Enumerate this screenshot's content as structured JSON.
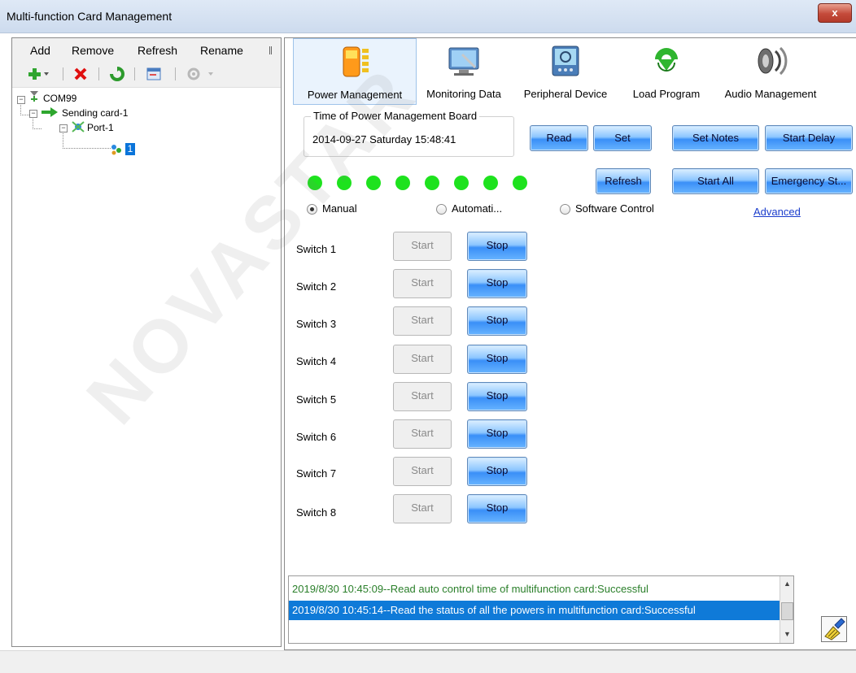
{
  "window": {
    "title": "Multi-function Card Management",
    "close_glyph": "x"
  },
  "menu": {
    "add": "Add",
    "remove": "Remove",
    "refresh": "Refresh",
    "rename": "Rename"
  },
  "tree": {
    "root": "COM99",
    "sending_card": "Sending card-1",
    "port": "Port-1",
    "card": "1"
  },
  "tabs": [
    {
      "label": "Power Management",
      "icon": "battery-icon"
    },
    {
      "label": "Monitoring Data",
      "icon": "monitor-icon"
    },
    {
      "label": "Peripheral Device",
      "icon": "device-icon"
    },
    {
      "label": "Load Program",
      "icon": "download-arrow-icon"
    },
    {
      "label": "Audio Management",
      "icon": "speaker-icon"
    }
  ],
  "time_group": {
    "legend": "Time of Power Management Board",
    "value": "2014-09-27 Saturday 15:48:41"
  },
  "buttons": {
    "read": "Read",
    "set": "Set",
    "set_notes": "Set Notes",
    "start_delay": "Start Delay",
    "refresh": "Refresh",
    "start_all": "Start All",
    "emergency_stop": "Emergency St..."
  },
  "status_leds": {
    "count": 8,
    "color": "#1ee21e"
  },
  "modes": {
    "manual": "Manual",
    "automatic": "Automati...",
    "software": "Software Control",
    "selected": "Manual",
    "advanced": "Advanced"
  },
  "switches": [
    {
      "label": "Switch 1",
      "start": "Start",
      "stop": "Stop"
    },
    {
      "label": "Switch 2",
      "start": "Start",
      "stop": "Stop"
    },
    {
      "label": "Switch 3",
      "start": "Start",
      "stop": "Stop"
    },
    {
      "label": "Switch 4",
      "start": "Start",
      "stop": "Stop"
    },
    {
      "label": "Switch 5",
      "start": "Start",
      "stop": "Stop"
    },
    {
      "label": "Switch 6",
      "start": "Start",
      "stop": "Stop"
    },
    {
      "label": "Switch 7",
      "start": "Start",
      "stop": "Stop"
    },
    {
      "label": "Switch 8",
      "start": "Start",
      "stop": "Stop"
    }
  ],
  "log": [
    "2019/8/30 10:45:09--Read auto control time of multifunction card:Successful",
    "2019/8/30 10:45:14--Read the status of all the powers in multifunction card:Successful"
  ],
  "watermark": "NOVASTAR",
  "colors": {
    "button_blue": "#3a8ff7",
    "selection": "#0f7ad8",
    "log_success": "#2a7f2a",
    "link": "#1a3ccc"
  }
}
